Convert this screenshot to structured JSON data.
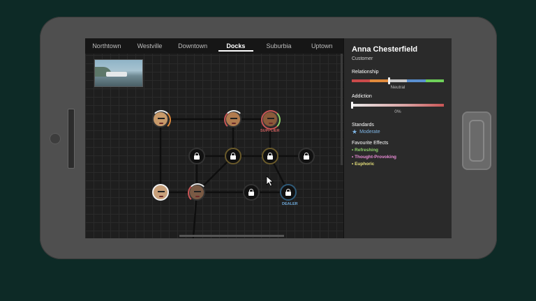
{
  "tabs": [
    "Northtown",
    "Westville",
    "Downtown",
    "Docks",
    "Suburbia",
    "Uptown"
  ],
  "active_tab": "Docks",
  "map": {
    "node_labels": {
      "supplier": "SUPPLIER",
      "dealer": "DEALER"
    }
  },
  "customer": {
    "name": "Anna Chesterfield",
    "role": "Customer",
    "relationship_heading": "Relationship",
    "relationship_value": "Neutral",
    "relationship_level": 0.4,
    "relationship_colors": [
      "#c94a4a",
      "#e08a3c",
      "#c9c9c9",
      "#5a8fd0",
      "#6fd05a"
    ],
    "addiction_heading": "Addiction",
    "addiction_value": "0%",
    "addiction_level": 0,
    "standards_heading": "Standards",
    "standards_value": "Moderate",
    "standards_icon": "star-icon",
    "effects_heading": "Favourite Effects",
    "effects": [
      {
        "label": "• Refreshing",
        "color": "#8fd06a"
      },
      {
        "label": "• Thought-Provoking",
        "color": "#e98bd6"
      },
      {
        "label": "• Euphoric",
        "color": "#e6e07a"
      }
    ]
  }
}
